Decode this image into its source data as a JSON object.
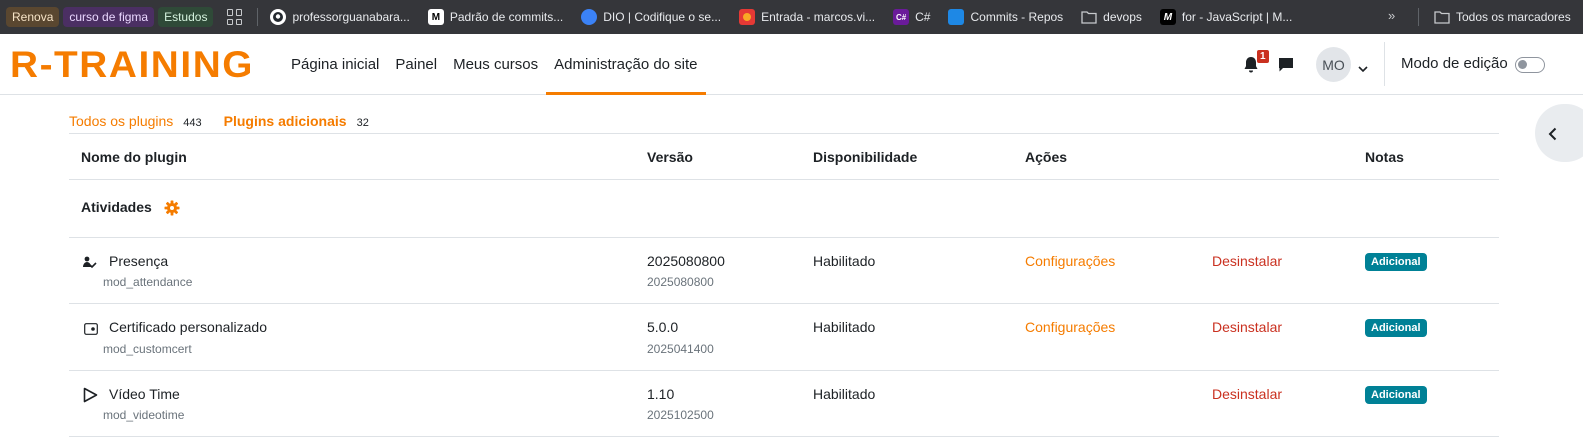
{
  "bookmarks": {
    "chips": [
      "Renova",
      "curso de figma",
      "Estudos"
    ],
    "items": [
      {
        "label": "professorguanabara...",
        "icon": "github-icon"
      },
      {
        "label": "Padrão de commits...",
        "icon": "medium-icon"
      },
      {
        "label": "DIO | Codifique o se...",
        "icon": "dio-icon"
      },
      {
        "label": "Entrada - marcos.vi...",
        "icon": "mail-icon"
      },
      {
        "label": "C#",
        "icon": "csharp-icon"
      },
      {
        "label": "Commits - Repos",
        "icon": "azure-devops-icon"
      },
      {
        "label": "devops",
        "icon": "folder-icon"
      },
      {
        "label": "for - JavaScript | M...",
        "icon": "mdn-icon"
      }
    ],
    "more": "»",
    "all_bookmarks": "Todos os marcadores"
  },
  "navbar": {
    "logo": "R-TRAINING",
    "links": [
      "Página inicial",
      "Painel",
      "Meus cursos",
      "Administração do site"
    ],
    "active_link": "Administração do site",
    "notification_count": "1",
    "avatar_initials": "MO",
    "edit_mode_label": "Modo de edição",
    "edit_mode_on": false
  },
  "filters": {
    "all_label": "Todos os plugins",
    "all_count": "443",
    "additional_label": "Plugins adicionais",
    "additional_count": "32"
  },
  "table": {
    "headers": [
      "Nome do plugin",
      "Versão",
      "Disponibilidade",
      "Ações",
      "Notas"
    ],
    "category": "Atividades",
    "rows": [
      {
        "name": "Presença",
        "component": "mod_attendance",
        "version": "2025080800",
        "build": "2025080800",
        "availability": "Habilitado",
        "settings": "Configurações",
        "uninstall": "Desinstalar",
        "note": "Adicional",
        "icon": "attendance-icon"
      },
      {
        "name": "Certificado personalizado",
        "component": "mod_customcert",
        "version": "5.0.0",
        "build": "2025041400",
        "availability": "Habilitado",
        "settings": "Configurações",
        "uninstall": "Desinstalar",
        "note": "Adicional",
        "icon": "certificate-icon"
      },
      {
        "name": "Vídeo Time",
        "component": "mod_videotime",
        "version": "1.10",
        "build": "2025102500",
        "availability": "Habilitado",
        "settings": "",
        "uninstall": "Desinstalar",
        "note": "Adicional",
        "icon": "play-icon"
      }
    ]
  },
  "colors": {
    "accent": "#f57c00",
    "danger": "#ca3120",
    "badge": "#008196",
    "bookmarks_bg": "#35363a"
  }
}
